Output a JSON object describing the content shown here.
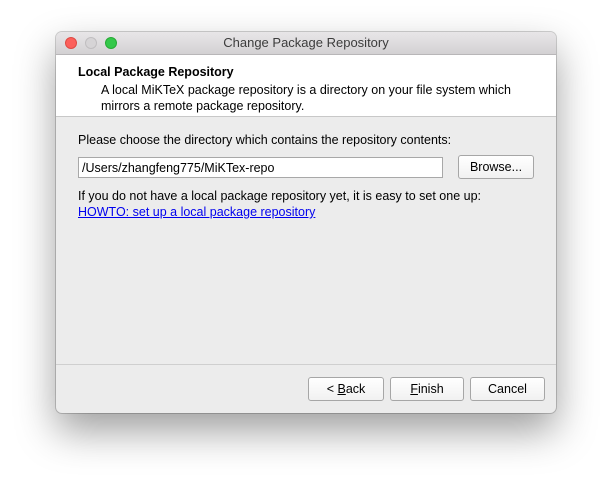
{
  "window": {
    "title": "Change Package Repository"
  },
  "header": {
    "title": "Local Package Repository",
    "description": "A local MiKTeX package repository is a directory on your file system which mirrors a remote package repository."
  },
  "body": {
    "prompt": "Please choose the directory which contains the repository contents:",
    "path_value": "/Users/zhangfeng775/MiKTex-repo",
    "browse_label": "Browse...",
    "info": "If you do not have a local package repository yet, it is easy to set one up:",
    "howto_link": "HOWTO: set up a local package repository"
  },
  "footer": {
    "back_prefix": "< ",
    "back_mnemonic": "B",
    "back_rest": "ack",
    "finish_mnemonic": "F",
    "finish_rest": "inish",
    "cancel_label": "Cancel"
  },
  "colors": {
    "close": "#fc605b",
    "minimize": "#d6d4d6",
    "zoom": "#34c84a",
    "link": "#0000ee"
  }
}
